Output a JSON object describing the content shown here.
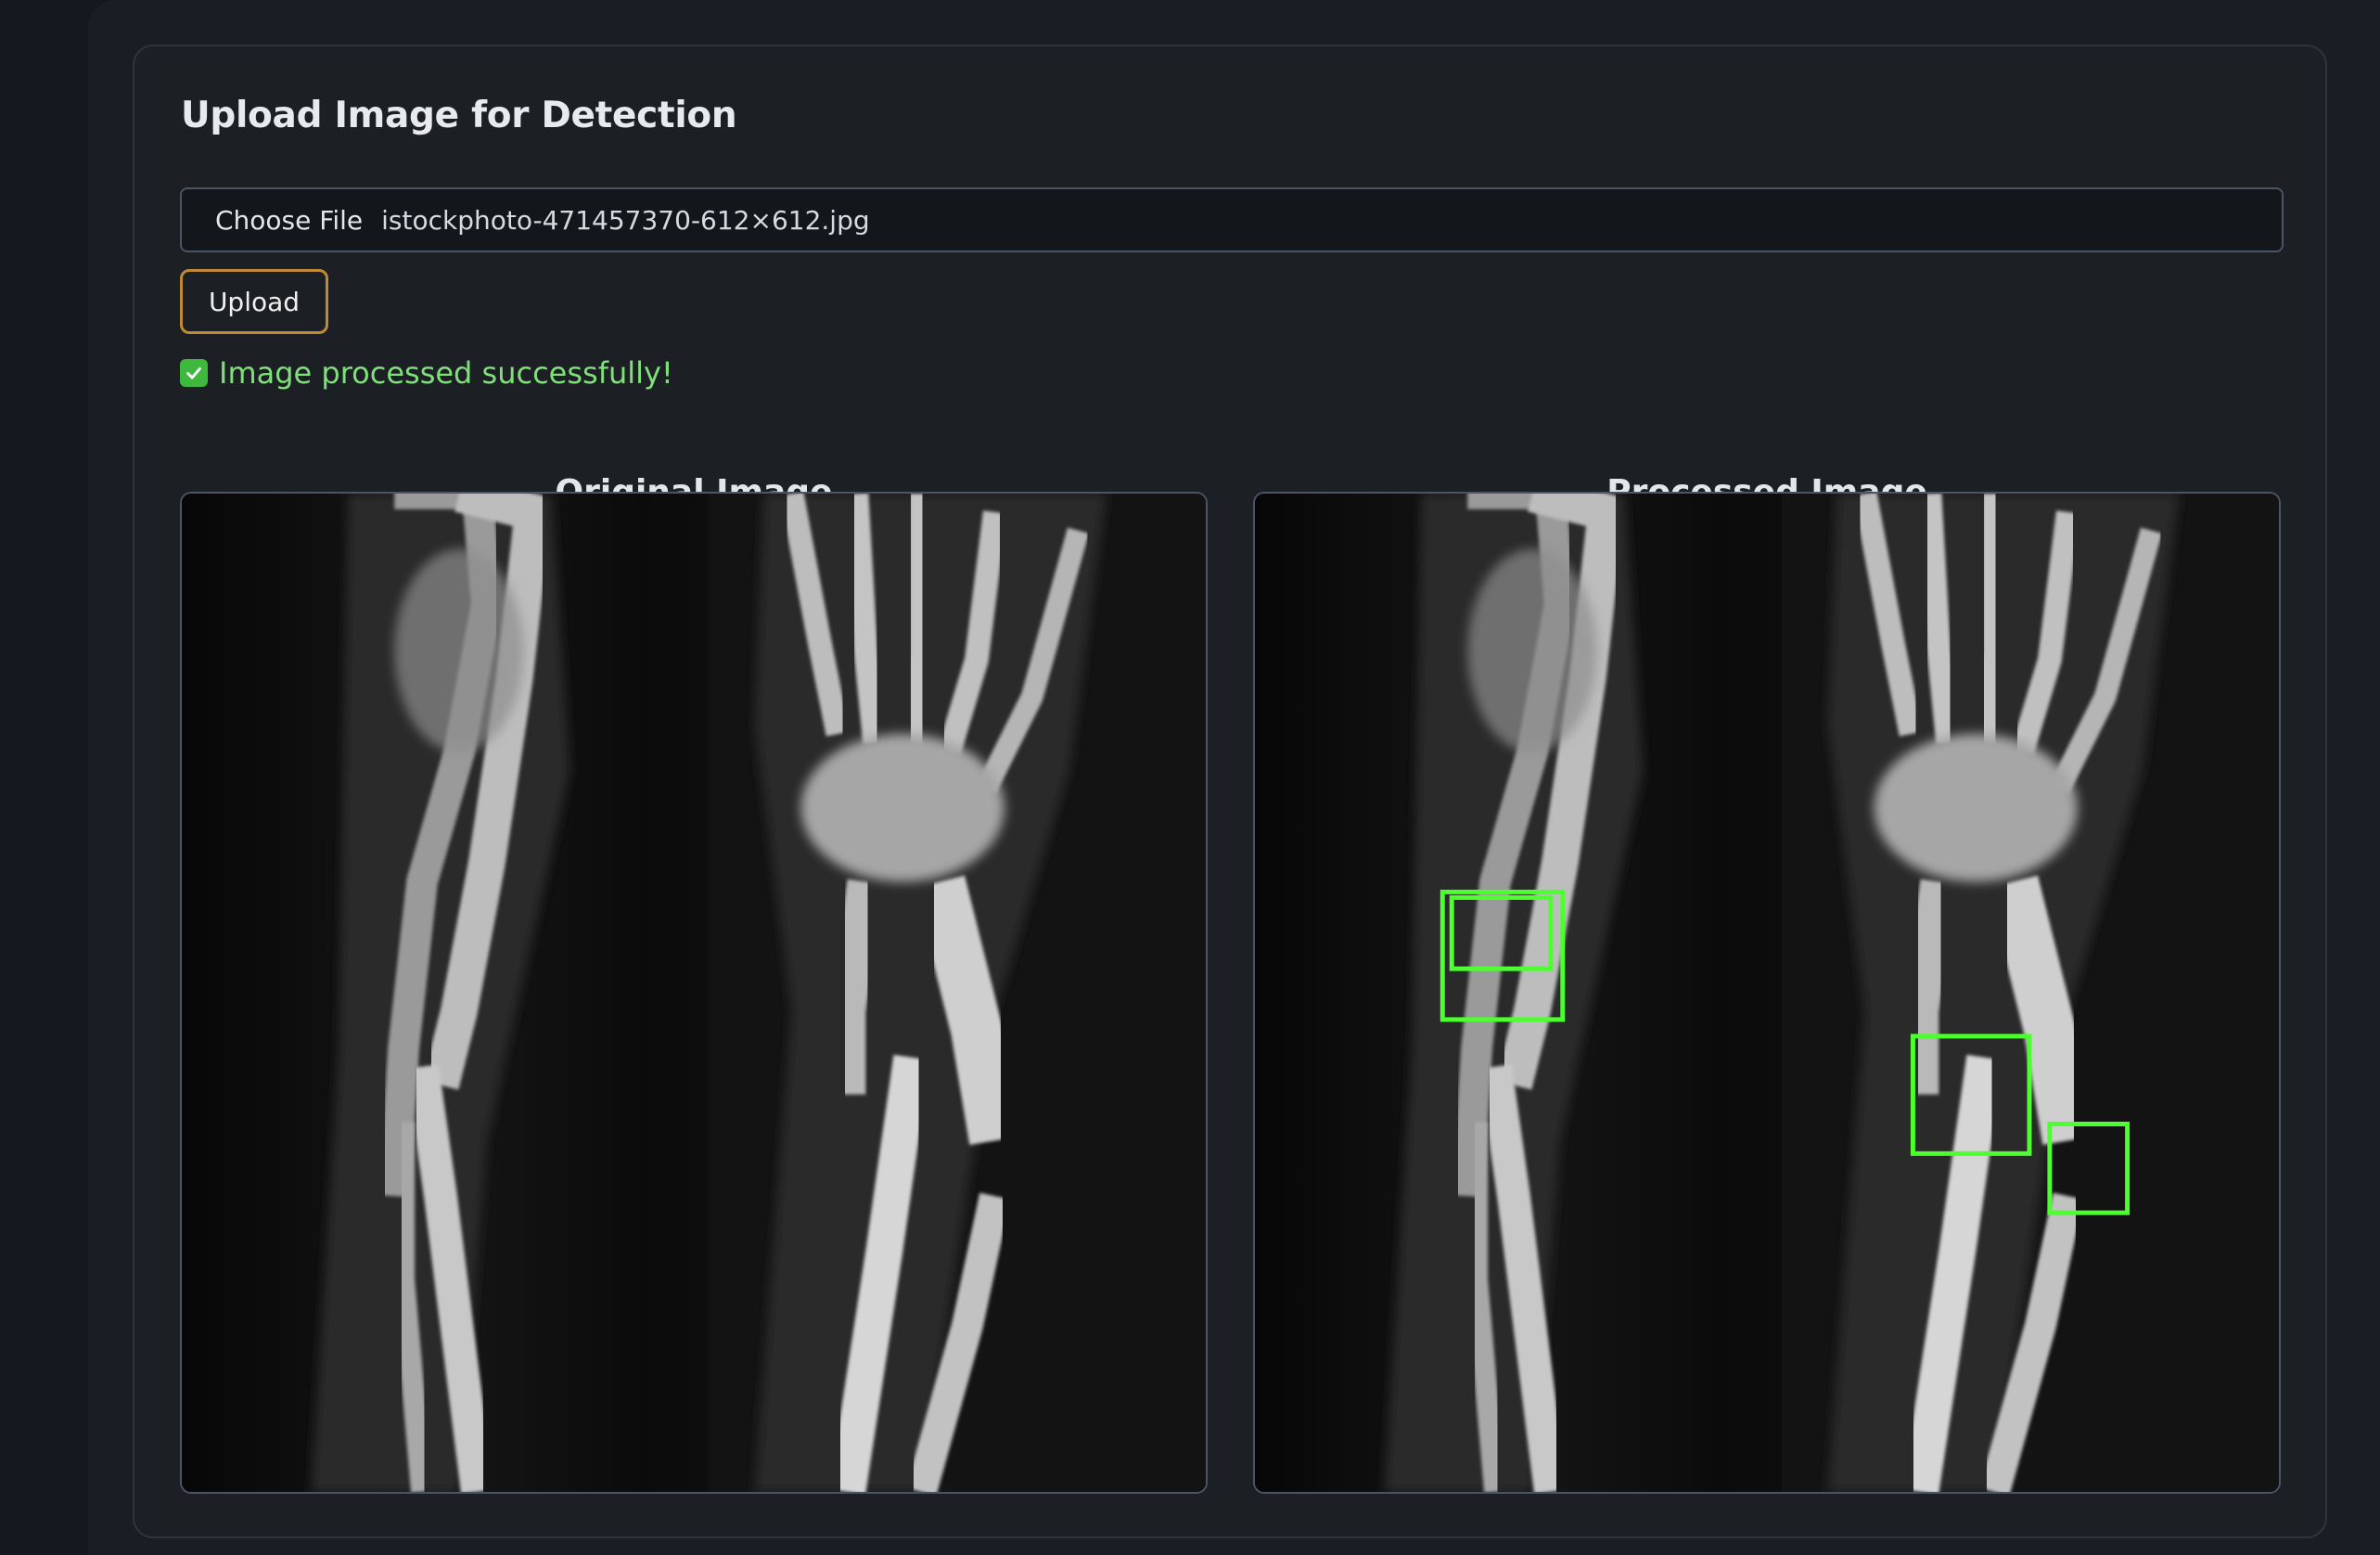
{
  "card": {
    "title": "Upload Image for Detection"
  },
  "file_input": {
    "button_label": "Choose File",
    "selected_file": "istockphoto-471457370-612×612.jpg"
  },
  "upload_button": {
    "label": "Upload"
  },
  "status": {
    "message": "Image processed successfully!",
    "color": "#7fe07a"
  },
  "images": {
    "original_label": "Original Image",
    "processed_label": "Processed Image"
  },
  "colors": {
    "accent_border": "#c08a35",
    "detection_box": "#4cff2e",
    "background": "#15191f"
  }
}
